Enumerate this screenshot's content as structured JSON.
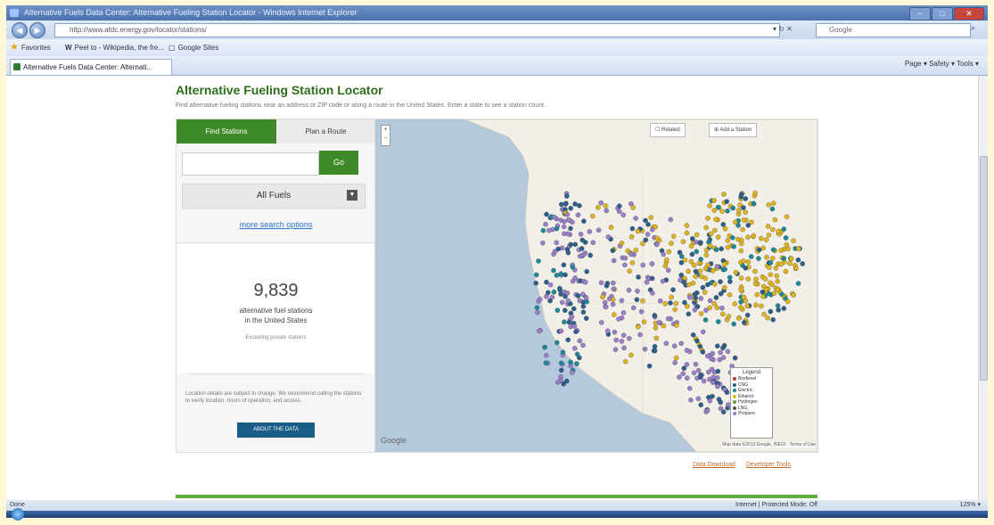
{
  "browser": {
    "title": "Alternative Fuels Data Center: Alternative Fueling Station Locator - Windows Internet Explorer",
    "url": "http://www.afdc.energy.gov/locator/stations/",
    "search_placeholder": "Google",
    "favorites_label": "Favorites",
    "fav_items": [
      "Peel to - Wikipedia, the fre...",
      "Google Sites"
    ],
    "tab_label": "Alternative Fuels Data Center: Alternati...",
    "command_bar": "Page ▾  Safety ▾  Tools ▾",
    "status_left": "Done",
    "status_zone": "Internet | Protected Mode: Off",
    "status_zoom": "125% ▾"
  },
  "page": {
    "title": "Alternative Fueling Station Locator",
    "subtitle": "Find alternative fueling stations near an address or ZIP code or along a route in the United States. Enter a state to see a station count."
  },
  "locator": {
    "tab_find": "Find Stations",
    "tab_route": "Plan a Route",
    "go_label": "Go",
    "fuel_select": "All Fuels",
    "more_options": "more search options",
    "count": "9,839",
    "count_label_1": "alternative fuel stations",
    "count_label_2": "in the United States",
    "excluding": "Excluding private stations",
    "disclaimer": "Location details are subject to change. We recommend calling the stations to verify location, hours of operation, and access.",
    "about_button": "ABOUT THE DATA"
  },
  "map": {
    "btn_related": "Related",
    "btn_add": "Add a Station",
    "legend_title": "Legend",
    "legend": [
      {
        "label": "Biodiesel",
        "color": "#c0392b"
      },
      {
        "label": "CNG",
        "color": "#2c5f8a"
      },
      {
        "label": "Electric",
        "color": "#1a8a9a"
      },
      {
        "label": "Ethanol",
        "color": "#e0b420"
      },
      {
        "label": "Hydrogen",
        "color": "#6a9a3a"
      },
      {
        "label": "LNG",
        "color": "#555555"
      },
      {
        "label": "Propane",
        "color": "#9b7fc9"
      }
    ],
    "google_label": "Google",
    "attribution": "Map data ©2013 Google, INEGI · Terms of Use",
    "zoom_plus": "+",
    "zoom_minus": "−"
  },
  "footer": {
    "data_download": "Data Download",
    "developer_tools": "Developer Tools"
  }
}
